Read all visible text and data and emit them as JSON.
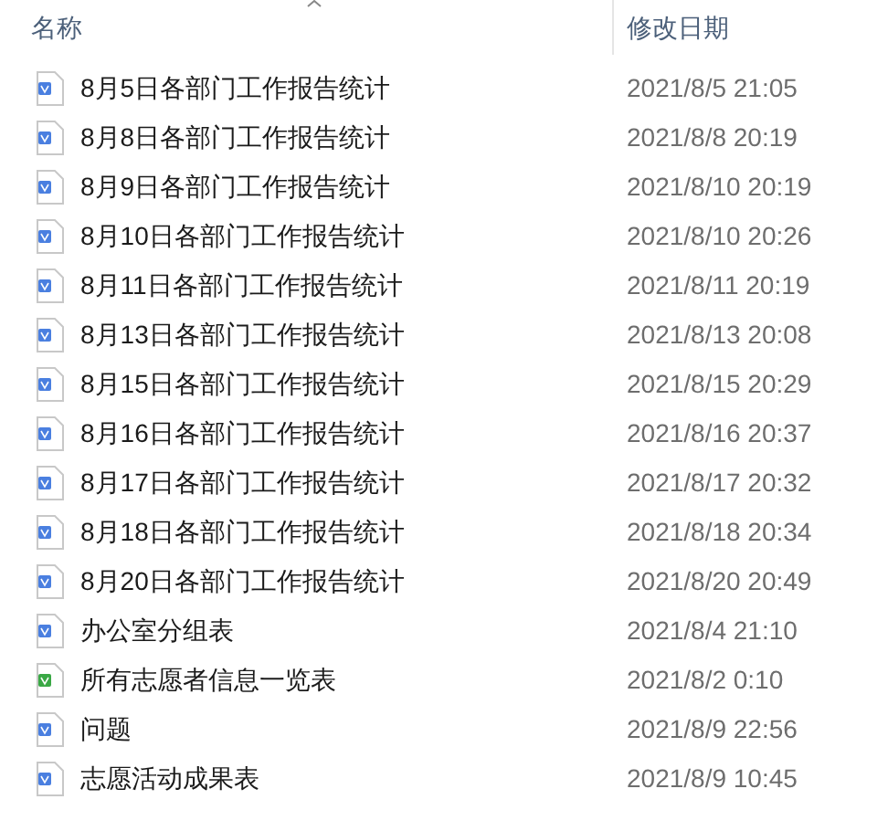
{
  "columns": [
    "名称",
    "修改日期"
  ],
  "files": [
    {
      "name": "8月5日各部门工作报告统计",
      "modified": "2021/8/5 21:05",
      "kind": "word"
    },
    {
      "name": "8月8日各部门工作报告统计",
      "modified": "2021/8/8 20:19",
      "kind": "word"
    },
    {
      "name": "8月9日各部门工作报告统计",
      "modified": "2021/8/10 20:19",
      "kind": "word"
    },
    {
      "name": "8月10日各部门工作报告统计",
      "modified": "2021/8/10 20:26",
      "kind": "word"
    },
    {
      "name": "8月11日各部门工作报告统计",
      "modified": "2021/8/11 20:19",
      "kind": "word"
    },
    {
      "name": "8月13日各部门工作报告统计",
      "modified": "2021/8/13 20:08",
      "kind": "word"
    },
    {
      "name": "8月15日各部门工作报告统计",
      "modified": "2021/8/15 20:29",
      "kind": "word"
    },
    {
      "name": "8月16日各部门工作报告统计",
      "modified": "2021/8/16 20:37",
      "kind": "word"
    },
    {
      "name": "8月17日各部门工作报告统计",
      "modified": "2021/8/17 20:32",
      "kind": "word"
    },
    {
      "name": "8月18日各部门工作报告统计",
      "modified": "2021/8/18 20:34",
      "kind": "word"
    },
    {
      "name": "8月20日各部门工作报告统计",
      "modified": "2021/8/20 20:49",
      "kind": "word"
    },
    {
      "name": "办公室分组表",
      "modified": "2021/8/4 21:10",
      "kind": "word"
    },
    {
      "name": "所有志愿者信息一览表",
      "modified": "2021/8/2 0:10",
      "kind": "sheet"
    },
    {
      "name": "问题",
      "modified": "2021/8/9 22:56",
      "kind": "word"
    },
    {
      "name": "志愿活动成果表",
      "modified": "2021/8/9 10:45",
      "kind": "word"
    }
  ]
}
